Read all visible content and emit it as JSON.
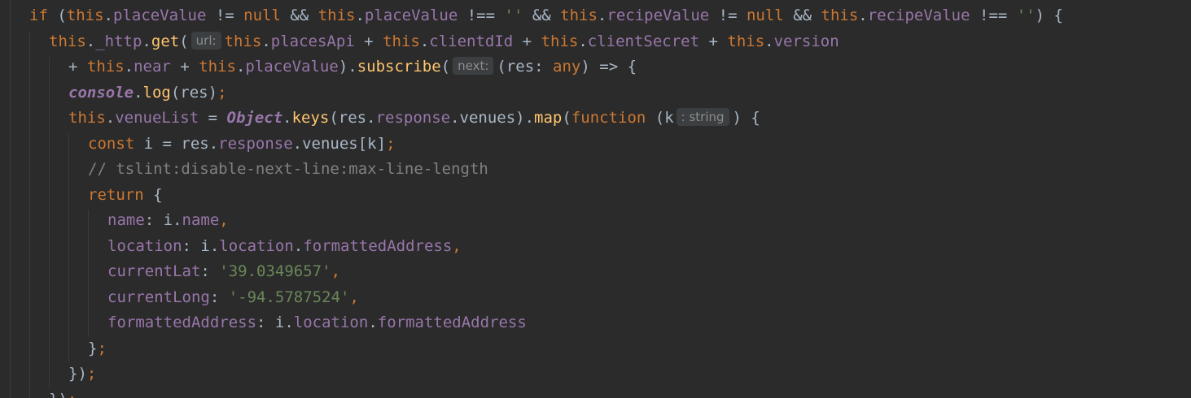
{
  "editor": {
    "theme_colors": {
      "background": "#2b2b2b",
      "default_text": "#a9b7c6",
      "keyword": "#cc7832",
      "field": "#9876aa",
      "function": "#ffc66d",
      "string": "#6a8759",
      "comment": "#808080",
      "hint_background": "#3b3f41",
      "hint_text": "#8c8c8c"
    },
    "lines": [
      {
        "segments": [
          {
            "t": "if",
            "c": "kw"
          },
          {
            "t": " (",
            "c": ""
          },
          {
            "t": "this",
            "c": "kw"
          },
          {
            "t": ".",
            "c": ""
          },
          {
            "t": "placeValue",
            "c": "fld"
          },
          {
            "t": " != ",
            "c": ""
          },
          {
            "t": "null",
            "c": "kw"
          },
          {
            "t": " && ",
            "c": ""
          },
          {
            "t": "this",
            "c": "kw"
          },
          {
            "t": ".",
            "c": ""
          },
          {
            "t": "placeValue",
            "c": "fld"
          },
          {
            "t": " !== ",
            "c": ""
          },
          {
            "t": "''",
            "c": "str"
          },
          {
            "t": " && ",
            "c": ""
          },
          {
            "t": "this",
            "c": "kw"
          },
          {
            "t": ".",
            "c": ""
          },
          {
            "t": "recipeValue",
            "c": "fld"
          },
          {
            "t": " != ",
            "c": ""
          },
          {
            "t": "null",
            "c": "kw"
          },
          {
            "t": " && ",
            "c": ""
          },
          {
            "t": "this",
            "c": "kw"
          },
          {
            "t": ".",
            "c": ""
          },
          {
            "t": "recipeValue",
            "c": "fld"
          },
          {
            "t": " !== ",
            "c": ""
          },
          {
            "t": "''",
            "c": "str"
          },
          {
            "t": ") {",
            "c": ""
          }
        ]
      },
      {
        "segments": [
          {
            "t": "this",
            "c": "kw"
          },
          {
            "t": ".",
            "c": ""
          },
          {
            "t": "_http",
            "c": "fld"
          },
          {
            "t": ".",
            "c": ""
          },
          {
            "t": "get",
            "c": "fn"
          },
          {
            "t": "(",
            "c": ""
          },
          {
            "t": "url:",
            "c": "hint"
          },
          {
            "t": "this",
            "c": "kw"
          },
          {
            "t": ".",
            "c": ""
          },
          {
            "t": "placesApi",
            "c": "fld"
          },
          {
            "t": " + ",
            "c": ""
          },
          {
            "t": "this",
            "c": "kw"
          },
          {
            "t": ".",
            "c": ""
          },
          {
            "t": "clientdId",
            "c": "fld"
          },
          {
            "t": " + ",
            "c": ""
          },
          {
            "t": "this",
            "c": "kw"
          },
          {
            "t": ".",
            "c": ""
          },
          {
            "t": "clientSecret",
            "c": "fld"
          },
          {
            "t": " + ",
            "c": ""
          },
          {
            "t": "this",
            "c": "kw"
          },
          {
            "t": ".",
            "c": ""
          },
          {
            "t": "version",
            "c": "fld"
          }
        ]
      },
      {
        "segments": [
          {
            "t": "+ ",
            "c": ""
          },
          {
            "t": "this",
            "c": "kw"
          },
          {
            "t": ".",
            "c": ""
          },
          {
            "t": "near",
            "c": "fld"
          },
          {
            "t": " + ",
            "c": ""
          },
          {
            "t": "this",
            "c": "kw"
          },
          {
            "t": ".",
            "c": ""
          },
          {
            "t": "placeValue",
            "c": "fld"
          },
          {
            "t": ").",
            "c": ""
          },
          {
            "t": "subscribe",
            "c": "fn"
          },
          {
            "t": "(",
            "c": ""
          },
          {
            "t": "next:",
            "c": "hint"
          },
          {
            "t": "(res: ",
            "c": ""
          },
          {
            "t": "any",
            "c": "kw"
          },
          {
            "t": ") => {",
            "c": ""
          }
        ]
      },
      {
        "segments": [
          {
            "t": "console",
            "c": "glb bold"
          },
          {
            "t": ".",
            "c": ""
          },
          {
            "t": "log",
            "c": "fn"
          },
          {
            "t": "(res)",
            "c": ""
          },
          {
            "t": ";",
            "c": "kw"
          }
        ]
      },
      {
        "segments": [
          {
            "t": "this",
            "c": "kw"
          },
          {
            "t": ".",
            "c": ""
          },
          {
            "t": "venueList",
            "c": "fld"
          },
          {
            "t": " = ",
            "c": ""
          },
          {
            "t": "Object",
            "c": "glb bold"
          },
          {
            "t": ".",
            "c": ""
          },
          {
            "t": "keys",
            "c": "fn"
          },
          {
            "t": "(res.",
            "c": ""
          },
          {
            "t": "response",
            "c": "fld"
          },
          {
            "t": ".venues).",
            "c": ""
          },
          {
            "t": "map",
            "c": "fn"
          },
          {
            "t": "(",
            "c": ""
          },
          {
            "t": "function",
            "c": "kw"
          },
          {
            "t": " (k",
            "c": ""
          },
          {
            "t": ": string",
            "c": "hint"
          },
          {
            "t": ") {",
            "c": ""
          }
        ]
      },
      {
        "segments": [
          {
            "t": "const",
            "c": "kw"
          },
          {
            "t": " i = res.",
            "c": ""
          },
          {
            "t": "response",
            "c": "fld"
          },
          {
            "t": ".venues[k]",
            "c": ""
          },
          {
            "t": ";",
            "c": "kw"
          }
        ]
      },
      {
        "segments": [
          {
            "t": "// tslint:disable-next-line:max-line-length",
            "c": "com"
          }
        ]
      },
      {
        "segments": [
          {
            "t": "return",
            "c": "kw"
          },
          {
            "t": " {",
            "c": ""
          }
        ]
      },
      {
        "segments": [
          {
            "t": "name",
            "c": "fld"
          },
          {
            "t": ": i.",
            "c": ""
          },
          {
            "t": "name",
            "c": "fld"
          },
          {
            "t": ",",
            "c": "kw"
          }
        ]
      },
      {
        "segments": [
          {
            "t": "location",
            "c": "fld"
          },
          {
            "t": ": i.",
            "c": ""
          },
          {
            "t": "location",
            "c": "fld"
          },
          {
            "t": ".",
            "c": ""
          },
          {
            "t": "formattedAddress",
            "c": "fld"
          },
          {
            "t": ",",
            "c": "kw"
          }
        ]
      },
      {
        "segments": [
          {
            "t": "currentLat",
            "c": "fld"
          },
          {
            "t": ": ",
            "c": ""
          },
          {
            "t": "'39.0349657'",
            "c": "str"
          },
          {
            "t": ",",
            "c": "kw"
          }
        ]
      },
      {
        "segments": [
          {
            "t": "currentLong",
            "c": "fld"
          },
          {
            "t": ": ",
            "c": ""
          },
          {
            "t": "'-94.5787524'",
            "c": "str"
          },
          {
            "t": ",",
            "c": "kw"
          }
        ]
      },
      {
        "segments": [
          {
            "t": "formattedAddress",
            "c": "fld"
          },
          {
            "t": ": i.",
            "c": ""
          },
          {
            "t": "location",
            "c": "fld"
          },
          {
            "t": ".",
            "c": ""
          },
          {
            "t": "formattedAddress",
            "c": "fld"
          }
        ]
      },
      {
        "segments": [
          {
            "t": "}",
            "c": ""
          },
          {
            "t": ";",
            "c": "kw"
          }
        ]
      },
      {
        "segments": [
          {
            "t": "})",
            "c": ""
          },
          {
            "t": ";",
            "c": "kw"
          }
        ]
      },
      {
        "segments": [
          {
            "t": "})",
            "c": ""
          },
          {
            "t": ";",
            "c": "kw"
          }
        ]
      }
    ]
  }
}
